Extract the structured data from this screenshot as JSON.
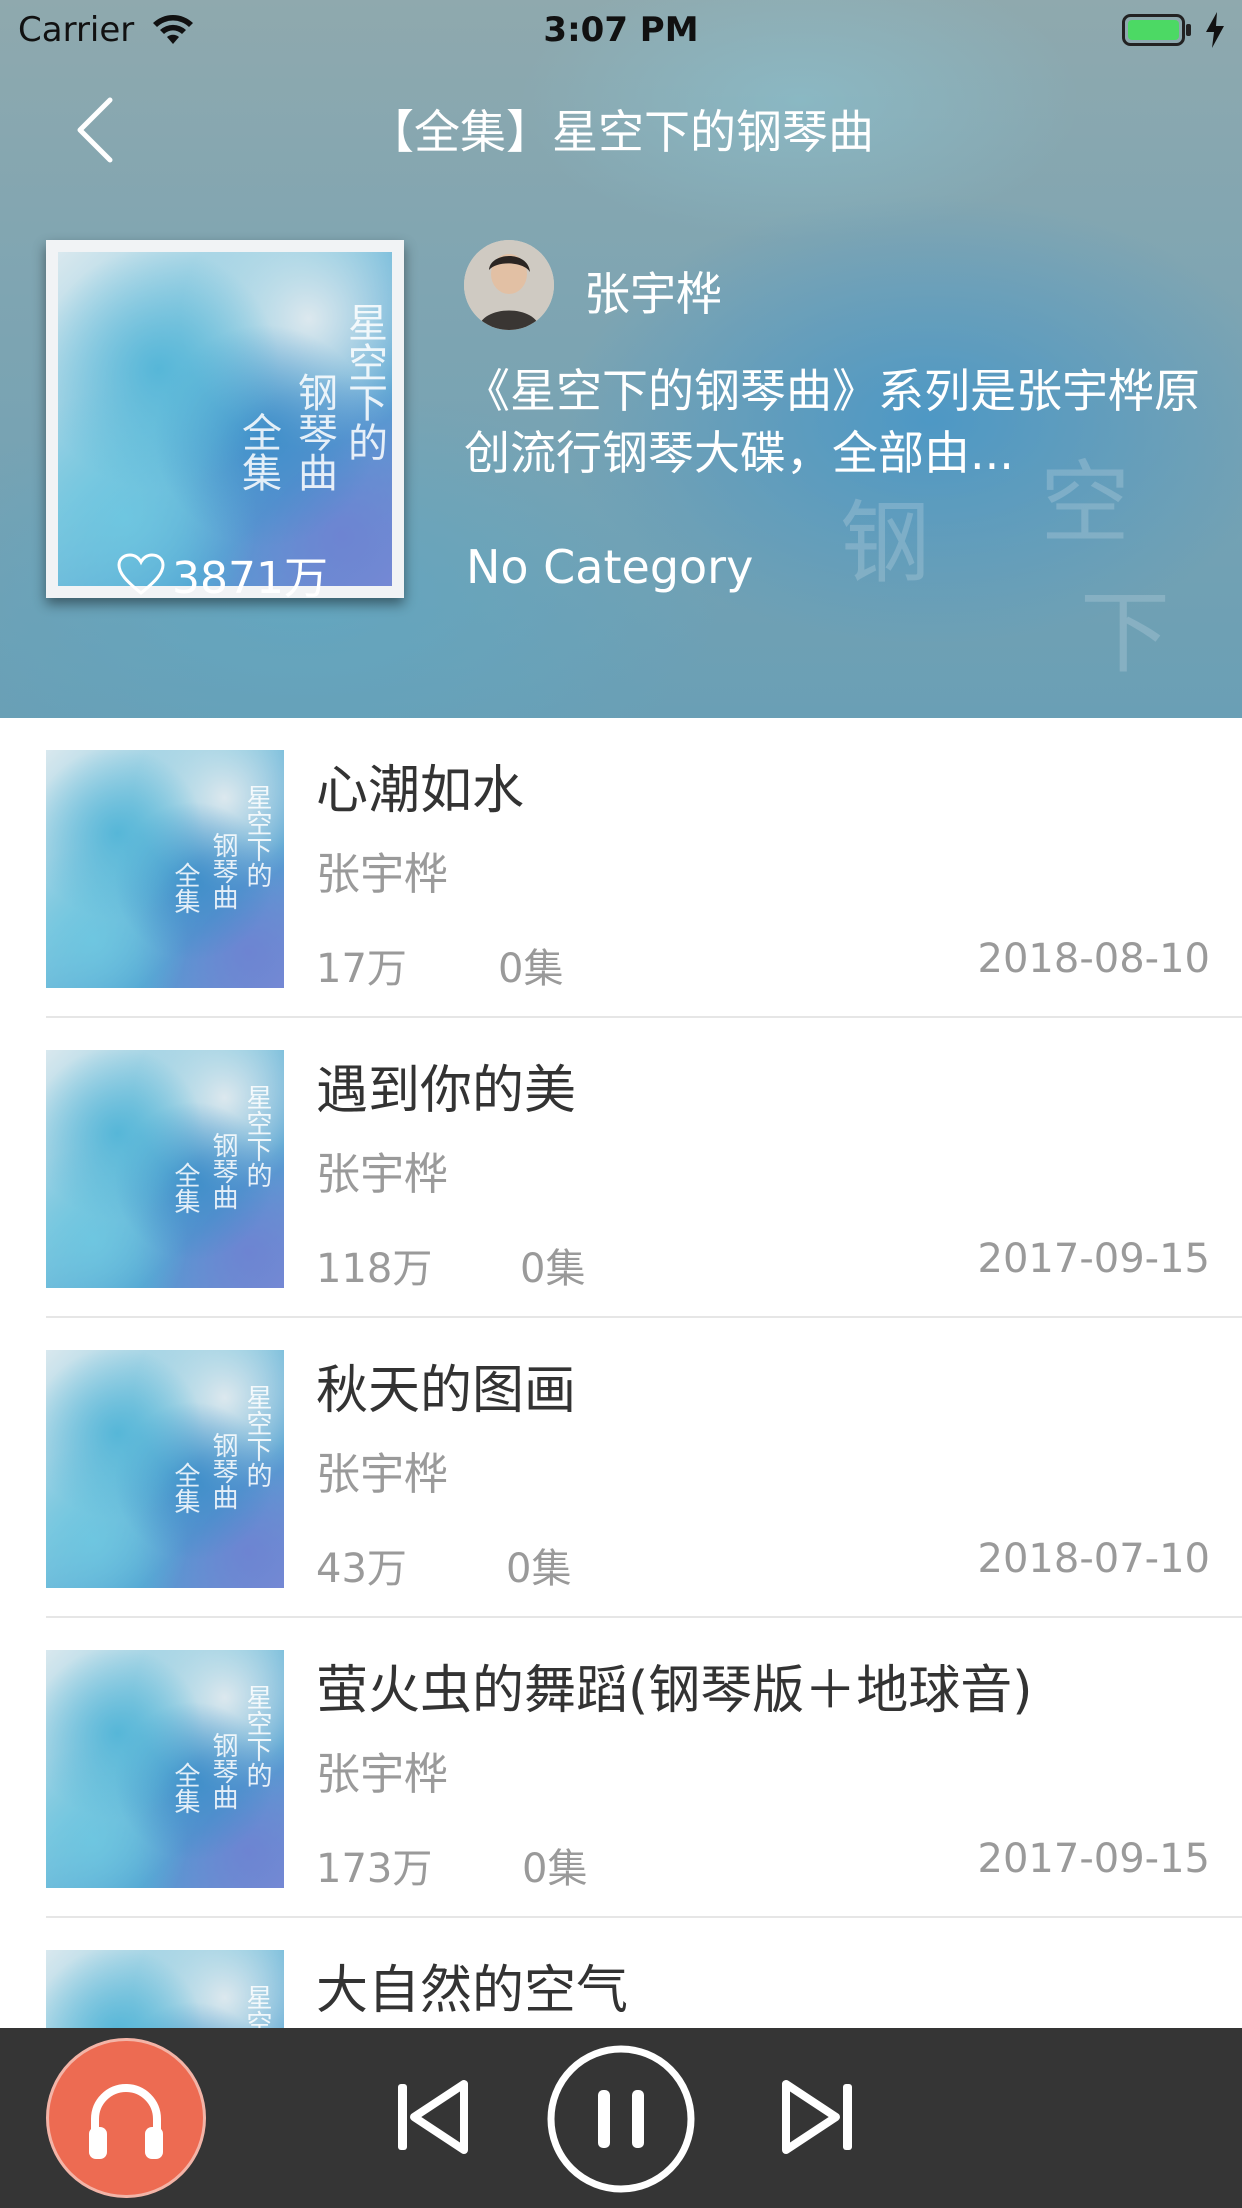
{
  "status_bar": {
    "carrier": "Carrier",
    "time": "3:07 PM"
  },
  "header": {
    "title": "【全集】星空下的钢琴曲",
    "artist_name": "张宇桦",
    "description": "《星空下的钢琴曲》系列是张宇桦原创流行钢琴大碟，全部由...",
    "category": "No Category",
    "like_count": "3871万",
    "cover_text": [
      "全集",
      "钢琴曲",
      "星空下的"
    ]
  },
  "tracks": [
    {
      "title": "心潮如水",
      "artist": "张宇桦",
      "plays": "17万",
      "episodes": "0集",
      "date": "2018-08-10"
    },
    {
      "title": "遇到你的美",
      "artist": "张宇桦",
      "plays": "118万",
      "episodes": "0集",
      "date": "2017-09-15"
    },
    {
      "title": "秋天的图画",
      "artist": "张宇桦",
      "plays": "43万",
      "episodes": "0集",
      "date": "2018-07-10"
    },
    {
      "title": "萤火虫的舞蹈(钢琴版＋地球音)",
      "artist": "张宇桦",
      "plays": "173万",
      "episodes": "0集",
      "date": "2017-09-15"
    },
    {
      "title": "大自然的空气",
      "artist": "",
      "plays": "",
      "episodes": "",
      "date": ""
    }
  ],
  "colors": {
    "accent": "#ed6b52",
    "player_bg": "#353535",
    "text_primary": "#333333",
    "text_secondary": "#9a9a9a"
  },
  "icons": [
    "back-icon",
    "wifi-icon",
    "battery-icon",
    "charging-icon",
    "heart-icon",
    "headphones-icon",
    "previous-icon",
    "pause-icon",
    "next-icon"
  ]
}
